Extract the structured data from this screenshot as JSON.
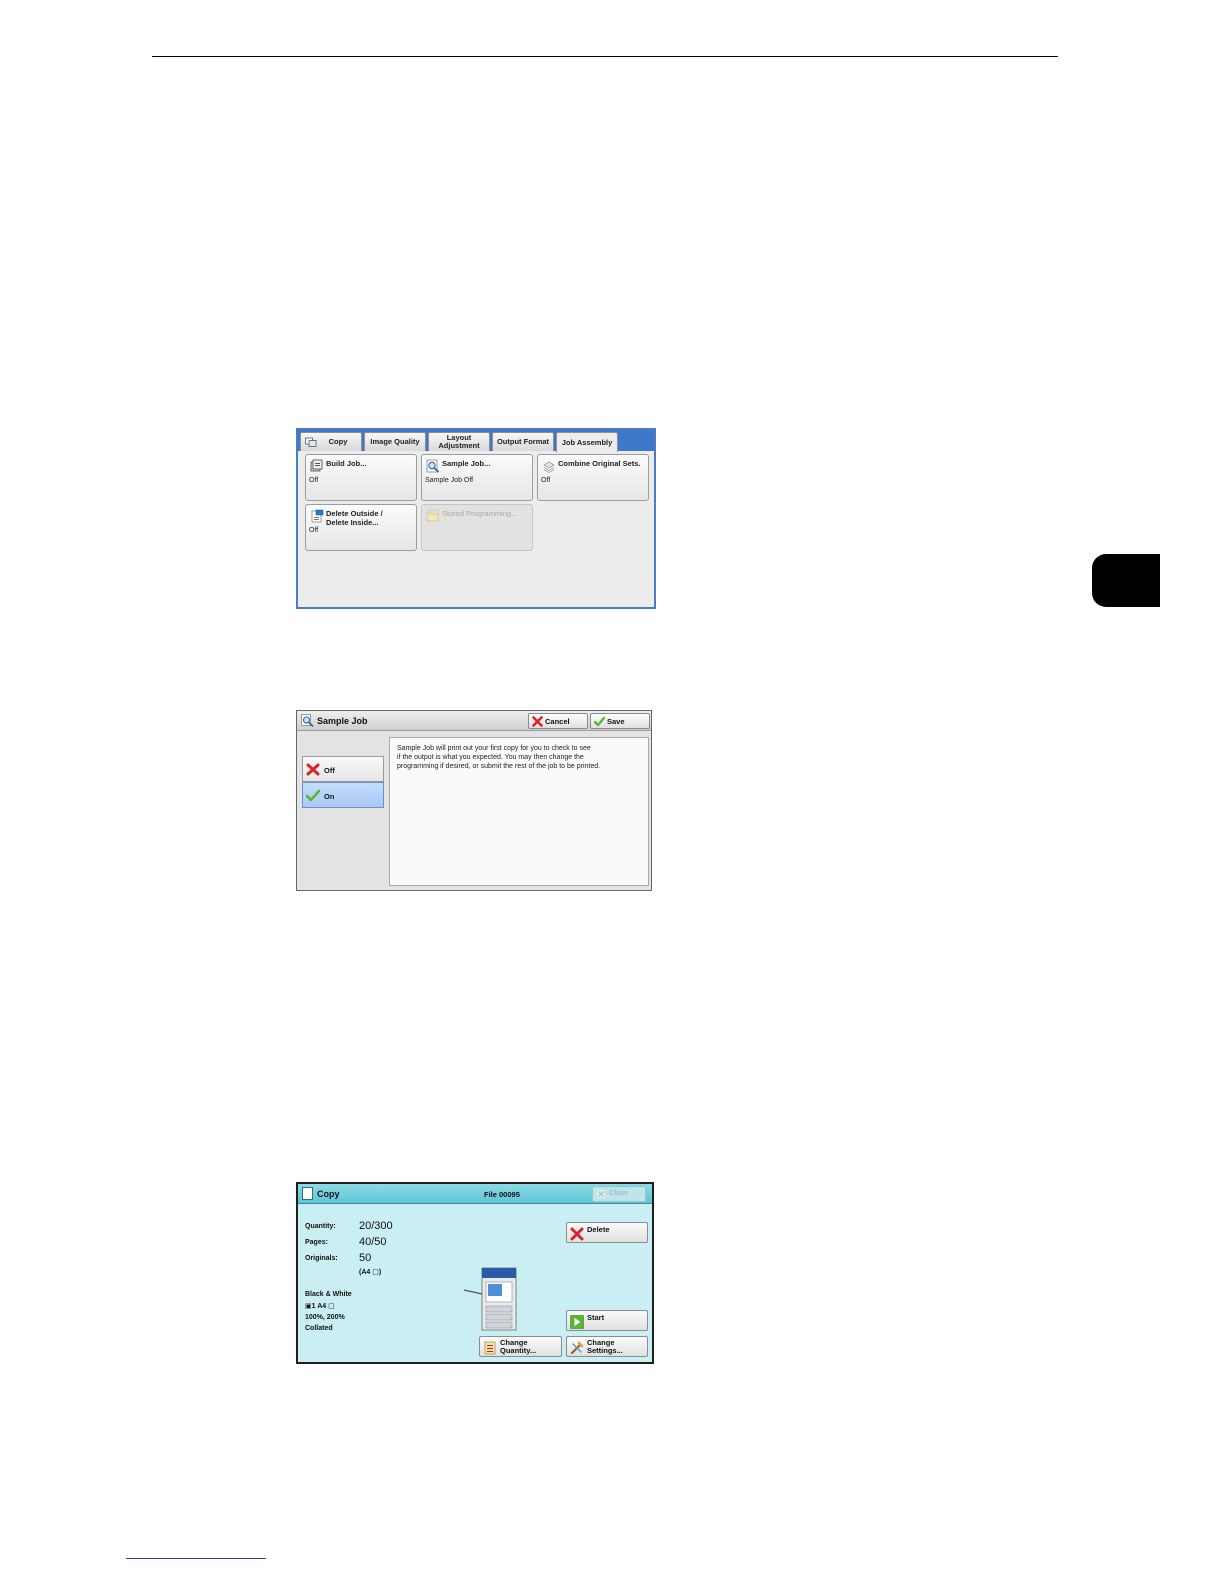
{
  "screen_job_assembly": {
    "tabs": [
      {
        "label": "Copy"
      },
      {
        "label": "Image Quality"
      },
      {
        "label": "Layout Adjustment"
      },
      {
        "label": "Output Format"
      },
      {
        "label": "Job Assembly"
      }
    ],
    "buttons": [
      {
        "label": "Build Job...",
        "value": "Off"
      },
      {
        "label": "Sample Job...",
        "value": "Sample Job Off"
      },
      {
        "label": "Combine Original Sets.",
        "value": "Off"
      },
      {
        "label_line1": "Delete Outside /",
        "label_line2": "Delete Inside...",
        "value": "Off"
      },
      {
        "label": "Stored Programming..."
      }
    ]
  },
  "screen_sample_job": {
    "title": "Sample Job",
    "cancel_label": "Cancel",
    "save_label": "Save",
    "options": [
      {
        "label": "Off"
      },
      {
        "label": "On"
      }
    ],
    "selected": "On",
    "description_lines": [
      "Sample Job will print out your first copy for you to check to see",
      "if the output is what you expected.  You may then change the",
      "programming if desired, or submit the rest of the job to be printed."
    ]
  },
  "screen_copy": {
    "title": "Copy",
    "file": "File 00095",
    "close_label": "Close",
    "quantity_label": "Quantity:",
    "quantity_value": "20/300",
    "pages_label": "Pages:",
    "pages_value": "40/50",
    "originals_label": "Originals:",
    "originals_value": "50",
    "originals_size": "(A4 ▢)",
    "settings_lines": [
      "Black & White",
      "▣1    A4 ▢",
      "100%, 200%",
      "Collated"
    ],
    "delete_label": "Delete",
    "start_label": "Start",
    "change_quantity_line1": "Change",
    "change_quantity_line2": "Quantity...",
    "change_settings_line1": "Change",
    "change_settings_line2": "Settings..."
  },
  "colors": {
    "tab_bar_blue": "#3f78c9",
    "copy_screen_cyan": "#c9eef3",
    "selected_option_blue": "#a9c8f3",
    "cancel_red": "#d8232a",
    "save_green": "#5bb534"
  }
}
